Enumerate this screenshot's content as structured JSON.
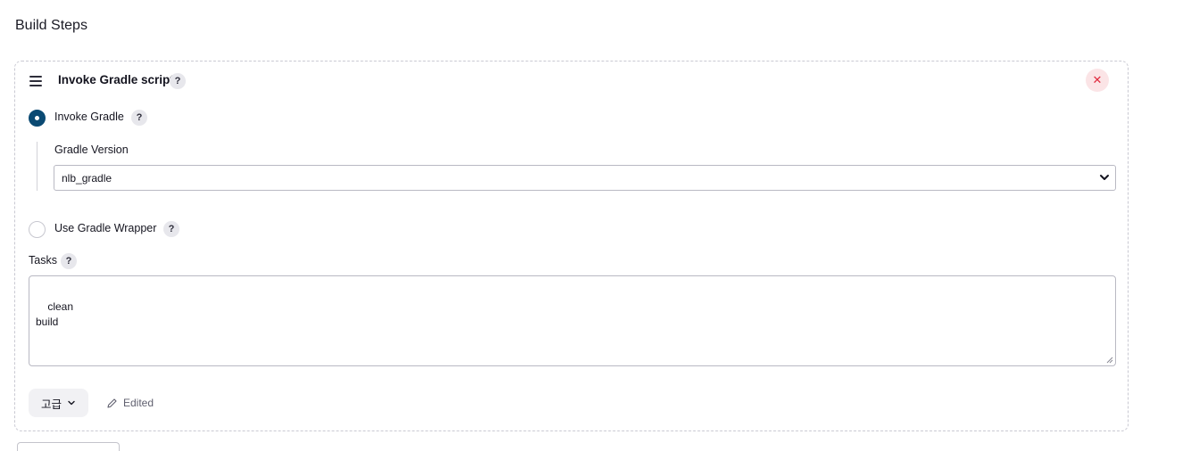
{
  "section": {
    "title": "Build Steps"
  },
  "step": {
    "title": "Invoke Gradle script",
    "help_label": "?",
    "close_label": "✕",
    "options": {
      "invoke_gradle": {
        "label": "Invoke Gradle",
        "checked": true,
        "help_label": "?"
      },
      "use_wrapper": {
        "label": "Use Gradle Wrapper",
        "checked": false,
        "help_label": "?"
      }
    },
    "gradle_version": {
      "label": "Gradle Version",
      "value": "nlb_gradle"
    },
    "tasks": {
      "label": "Tasks",
      "help_label": "?",
      "value": "clean\nbuild"
    },
    "advanced_button": {
      "label": "고급"
    },
    "edited": {
      "label": "Edited"
    }
  },
  "colors": {
    "accent": "#0b4a73",
    "danger": "#e02a3e",
    "danger_bg": "#fbe4e6"
  },
  "icons": {
    "drag": "drag-handle-icon",
    "close": "close-icon",
    "chevron": "chevron-down-icon",
    "pencil": "pencil-icon"
  }
}
